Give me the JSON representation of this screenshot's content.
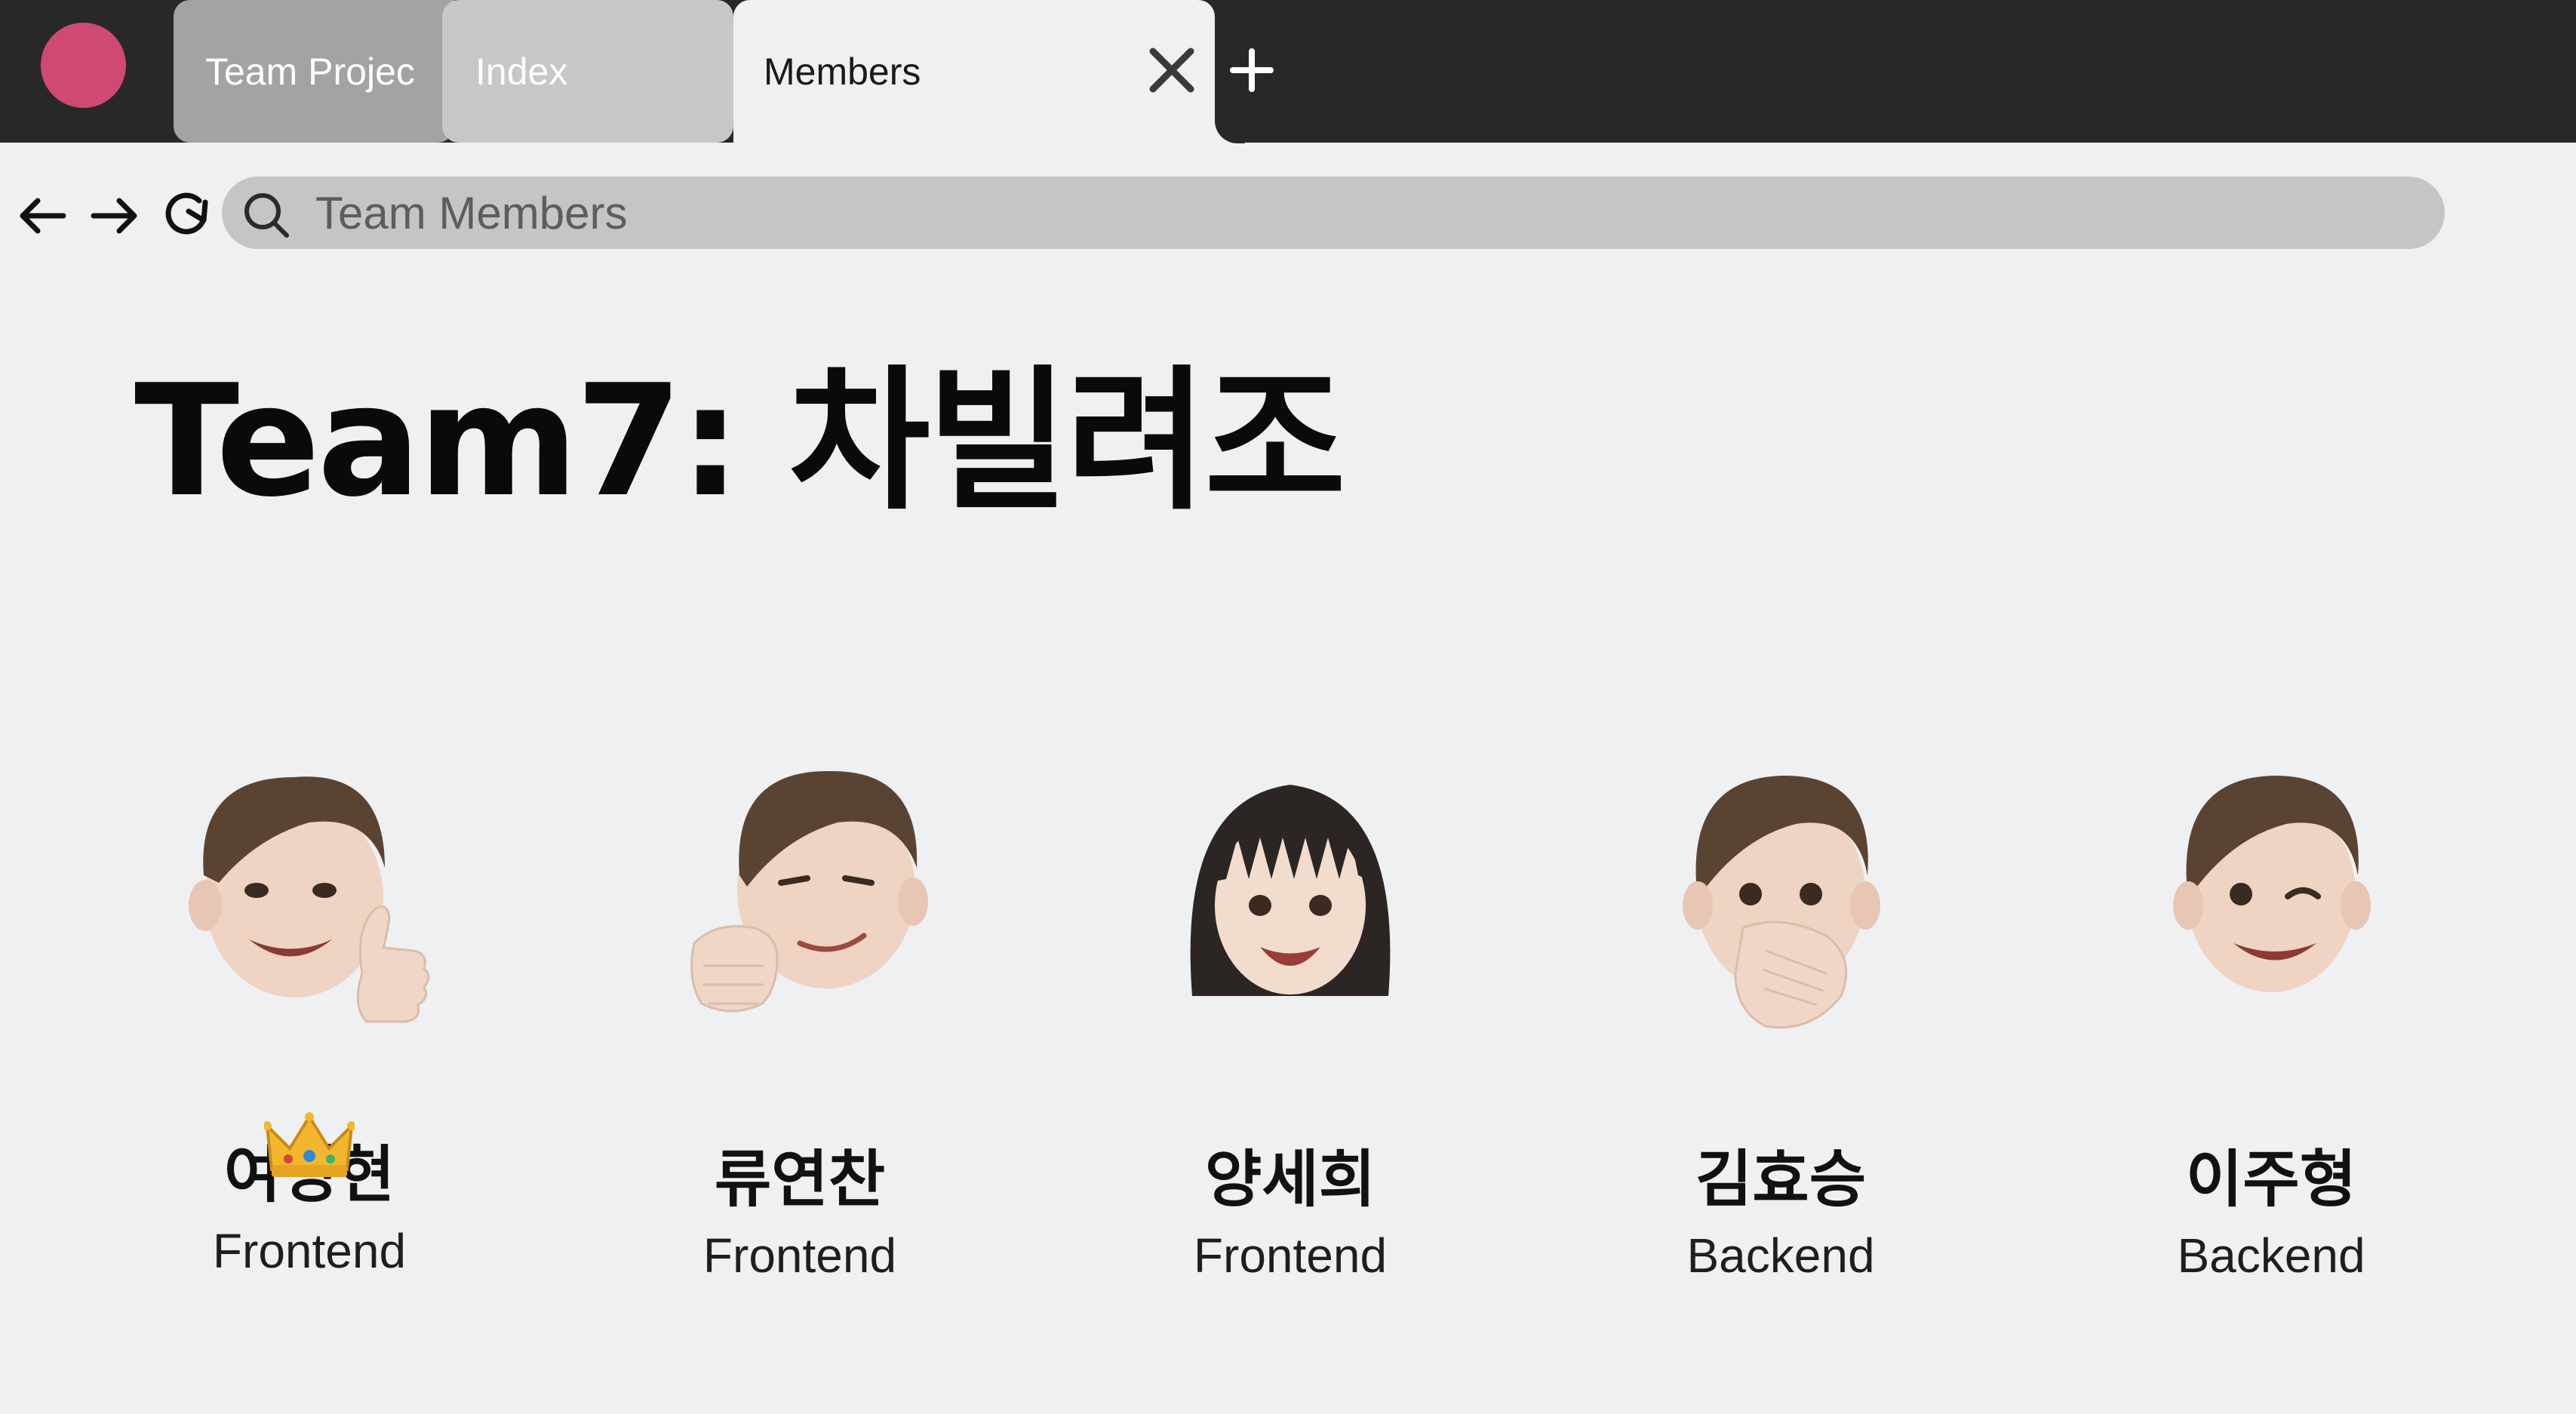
{
  "colors": {
    "tabbar_bg": "#282828",
    "window_dot": "#ce4a72",
    "page_bg": "#eff0f2",
    "address_bg": "#c4c5c7"
  },
  "tabs": [
    {
      "label": "Team Projec",
      "active": false
    },
    {
      "label": "Index",
      "active": false
    },
    {
      "label": "Members",
      "active": true
    }
  ],
  "address_bar": {
    "placeholder": "Team Members",
    "icon": "search-icon"
  },
  "nav_icons": [
    "back-arrow-icon",
    "forward-arrow-icon",
    "reload-icon"
  ],
  "page_title": "Team7: 차빌려조",
  "members": [
    {
      "name": "여명현",
      "role": "Frontend",
      "leader": true,
      "avatar": "thumbs-up-boy-memoji"
    },
    {
      "name": "류연찬",
      "role": "Frontend",
      "leader": false,
      "avatar": "fist-bump-boy-memoji"
    },
    {
      "name": "양세희",
      "role": "Frontend",
      "leader": false,
      "avatar": "smiling-girl-memoji"
    },
    {
      "name": "김효승",
      "role": "Backend",
      "leader": false,
      "avatar": "hand-over-mouth-boy-memoji"
    },
    {
      "name": "이주형",
      "role": "Backend",
      "leader": false,
      "avatar": "winking-boy-memoji"
    }
  ]
}
